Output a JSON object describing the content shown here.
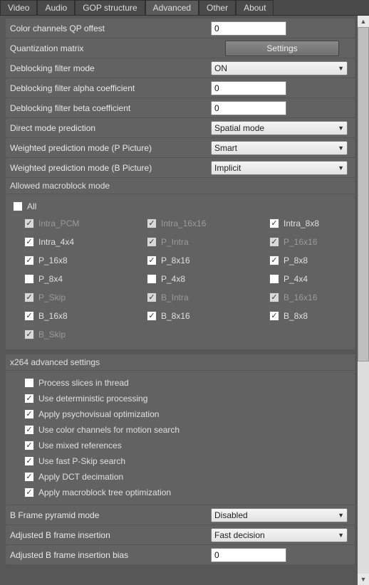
{
  "tabs": {
    "t0": "Video",
    "t1": "Audio",
    "t2": "GOP structure",
    "t3": "Advanced",
    "t4": "Other",
    "t5": "About"
  },
  "rows": {
    "colorQP": {
      "label": "Color channels QP offest",
      "value": "0"
    },
    "qmatrix": {
      "label": "Quantization matrix",
      "button": "Settings"
    },
    "deblockMode": {
      "label": "Deblocking filter mode",
      "value": "ON"
    },
    "deblockAlpha": {
      "label": "Deblocking filter alpha coefficient",
      "value": "0"
    },
    "deblockBeta": {
      "label": "Deblocking filter beta coefficient",
      "value": "0"
    },
    "directMode": {
      "label": "Direct mode prediction",
      "value": "Spatial mode"
    },
    "wpP": {
      "label": "Weighted prediction mode (P Picture)",
      "value": "Smart"
    },
    "wpB": {
      "label": "Weighted prediction mode (B Picture)",
      "value": "Implicit"
    },
    "bpyramid": {
      "label": "B Frame pyramid mode",
      "value": "Disabled"
    },
    "adjB": {
      "label": "Adjusted B frame insertion",
      "value": "Fast decision"
    },
    "adjBBias": {
      "label": "Adjusted B frame insertion bias",
      "value": "0"
    }
  },
  "macro": {
    "head": "Allowed macroblock mode",
    "all": "All",
    "c": {
      "intra_pcm": "Intra_PCM",
      "intra_16x16": "Intra_16x16",
      "intra_8x8": "Intra_8x8",
      "intra_4x4": "Intra_4x4",
      "p_intra": "P_Intra",
      "p_16x16": "P_16x16",
      "p_16x8": "P_16x8",
      "p_8x16": "P_8x16",
      "p_8x8": "P_8x8",
      "p_8x4": "P_8x4",
      "p_4x8": "P_4x8",
      "p_4x4": "P_4x4",
      "p_skip": "P_Skip",
      "b_intra": "B_Intra",
      "b_16x16": "B_16x16",
      "b_16x8": "B_16x8",
      "b_8x16": "B_8x16",
      "b_8x8": "B_8x8",
      "b_skip": "B_Skip"
    }
  },
  "x264": {
    "head": "x264 advanced settings",
    "c": {
      "threads": "Process slices in thread",
      "deterministic": "Use deterministic processing",
      "psy": "Apply psychovisual optimization",
      "chroma": "Use color channels for motion search",
      "mixed": "Use mixed references",
      "pskip": "Use fast P-Skip search",
      "dct": "Apply DCT decimation",
      "mbtree": "Apply macroblock tree optimization"
    }
  }
}
